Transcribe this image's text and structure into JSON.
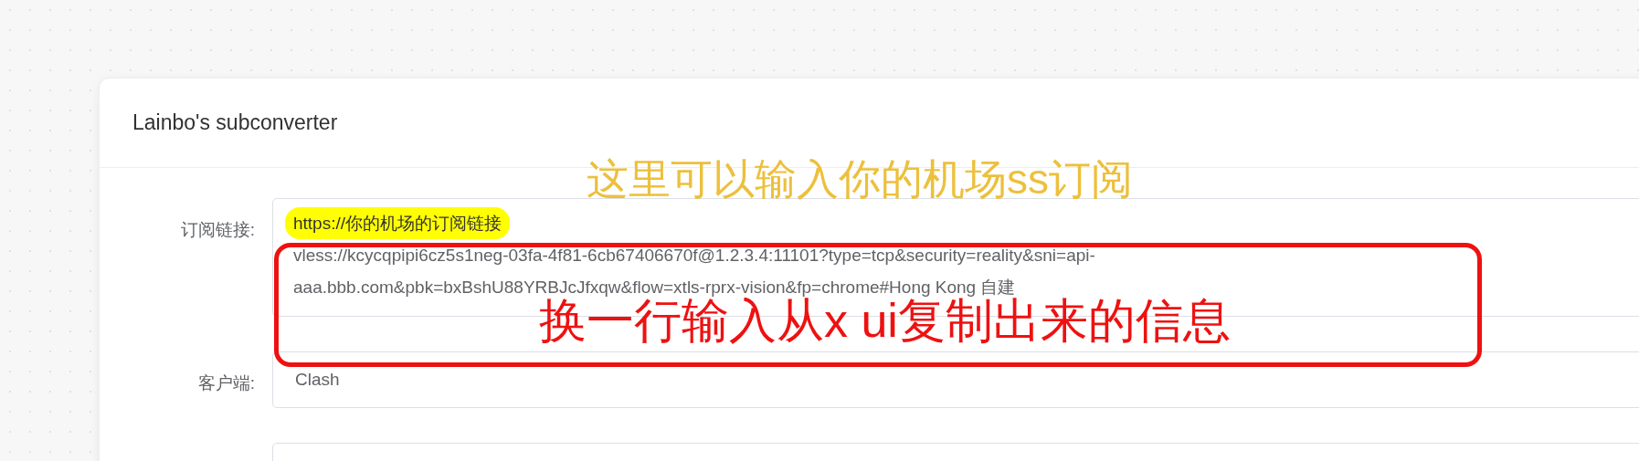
{
  "card": {
    "title": "Lainbo's subconverter"
  },
  "form": [
    {
      "kind": "textarea",
      "label": "订阅链接:",
      "highlighted": "https://你的机场的订阅链接",
      "value": "vless://kcycqpipi6cz5s1neg-03fa-4f81-6cb67406670f@1.2.3.4:11101?type=tcp&security=reality&sni=api-aaa.bbb.com&pbk=bxBshU88YRBJcJfxqw&flow=xtls-rprx-vision&fp=chrome#Hong Kong 自建"
    },
    {
      "kind": "select",
      "label": "客户端:",
      "value": "Clash"
    },
    {
      "kind": "select"
    }
  ],
  "annotations": [
    {
      "kind": "note",
      "text": "这里可以输入你的机场ss订阅",
      "color": "#ecc03c"
    },
    {
      "kind": "frame",
      "text": "换一行输入从x ui复制出来的信息",
      "color": "#ee1111"
    }
  ]
}
